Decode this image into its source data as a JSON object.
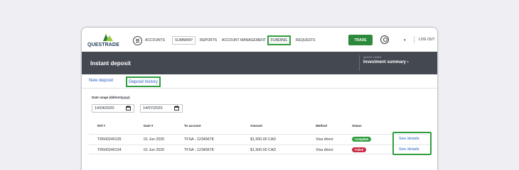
{
  "logo": {
    "text": "QUESTRADE"
  },
  "nav": {
    "items": [
      {
        "label": "ACCOUNTS"
      },
      {
        "label": "SUMMARY"
      },
      {
        "label": "REPORTS"
      },
      {
        "label": "ACCOUNT MANAGEMENT"
      },
      {
        "label": "FUNDING"
      },
      {
        "label": "REQUESTS"
      }
    ],
    "trade_label": "TRADE",
    "logout_label": "LOG OUT",
    "caret": "▾"
  },
  "banner": {
    "title": "Instant deposit",
    "quick_links_label": "QUICK LINKS",
    "investment_summary": "Investment summary ›"
  },
  "tabs": [
    {
      "label": "New deposit"
    },
    {
      "label": "Deposit history"
    }
  ],
  "filters": {
    "date_range_label": "Date range (dd/mm/yyyy)",
    "start_date": "14/04/2020",
    "end_date": "14/07/2020"
  },
  "table": {
    "columns": [
      "Ref #",
      "Date ▾",
      "To account",
      "Amount",
      "Method",
      "Status"
    ],
    "rows": [
      {
        "ref": "TR500240135",
        "date": "01 Jun 2020",
        "account": "TFSA - 12345678",
        "amount": "$1,500.00 CAD",
        "method": "Visa direct",
        "status": "Complete",
        "details": "See details"
      },
      {
        "ref": "TR500240134",
        "date": "01 Jun 2020",
        "account": "TFSA - 12345678",
        "amount": "$1,500.00 CAD",
        "method": "Visa direct",
        "status": "Failed",
        "details": "See details"
      }
    ]
  },
  "colors": {
    "accent_green": "#2f9e3f",
    "link_blue": "#2a61c2",
    "banner_bg": "#444851",
    "status_complete": "#2f9e3f",
    "status_failed": "#c7283f"
  }
}
